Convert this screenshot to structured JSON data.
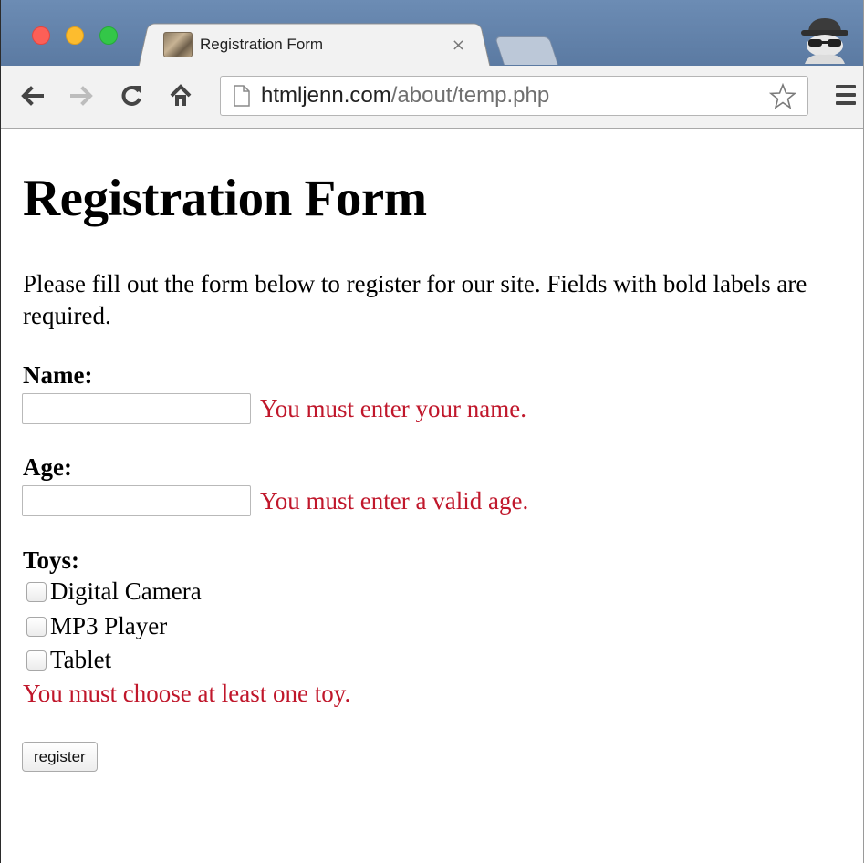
{
  "browser": {
    "tab_title": "Registration Form",
    "tab_close": "×",
    "url_host": "htmljenn.com",
    "url_path": "/about/temp.php"
  },
  "page": {
    "heading": "Registration Form",
    "intro": "Please fill out the form below to register for our site. Fields with bold labels are required.",
    "name_label": "Name:",
    "name_value": "",
    "name_error": "You must enter your name.",
    "age_label": "Age:",
    "age_value": "",
    "age_error": "You must enter a valid age.",
    "toys_label": "Toys:",
    "toys": [
      {
        "label": "Digital Camera",
        "checked": false
      },
      {
        "label": "MP3 Player",
        "checked": false
      },
      {
        "label": "Tablet",
        "checked": false
      }
    ],
    "toys_error": "You must choose at least one toy.",
    "submit_label": "register"
  },
  "colors": {
    "error": "#c0172b",
    "tabstrip": "#5b7aa2"
  },
  "icons": [
    "back-arrow-icon",
    "forward-arrow-icon",
    "reload-icon",
    "home-icon",
    "page-icon",
    "bookmark-star-icon",
    "menu-icon",
    "incognito-icon",
    "favicon-dog"
  ]
}
